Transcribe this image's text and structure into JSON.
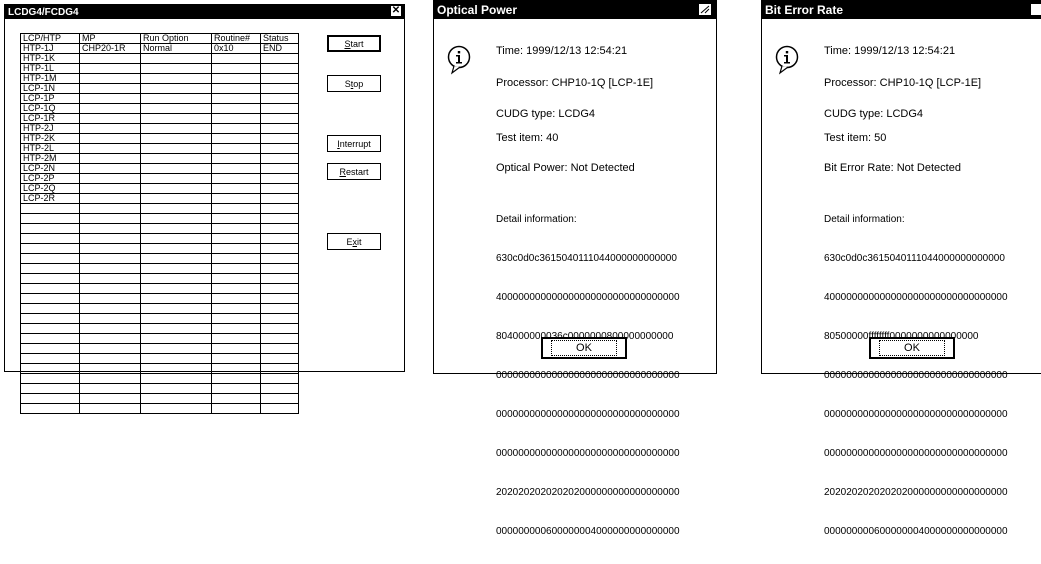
{
  "win1": {
    "title": "LCDG4/FCDG4",
    "close_glyph": "✕",
    "columns": [
      "LCP/HTP",
      "MP",
      "Run Option",
      "Routine#",
      "Status"
    ],
    "rows": [
      [
        "HTP-1J",
        "CHP20-1R",
        "Normal",
        "0x10",
        "END"
      ],
      [
        "HTP-1K",
        "",
        "",
        "",
        ""
      ],
      [
        "HTP-1L",
        "",
        "",
        "",
        ""
      ],
      [
        "HTP-1M",
        "",
        "",
        "",
        ""
      ],
      [
        "LCP-1N",
        "",
        "",
        "",
        ""
      ],
      [
        "LCP-1P",
        "",
        "",
        "",
        ""
      ],
      [
        "LCP-1Q",
        "",
        "",
        "",
        ""
      ],
      [
        "LCP-1R",
        "",
        "",
        "",
        ""
      ],
      [
        "HTP-2J",
        "",
        "",
        "",
        ""
      ],
      [
        "HTP-2K",
        "",
        "",
        "",
        ""
      ],
      [
        "HTP-2L",
        "",
        "",
        "",
        ""
      ],
      [
        "HTP-2M",
        "",
        "",
        "",
        ""
      ],
      [
        "LCP-2N",
        "",
        "",
        "",
        ""
      ],
      [
        "LCP-2P",
        "",
        "",
        "",
        ""
      ],
      [
        "LCP-2Q",
        "",
        "",
        "",
        ""
      ],
      [
        "LCP-2R",
        "",
        "",
        "",
        ""
      ],
      [
        "",
        "",
        "",
        "",
        ""
      ],
      [
        "",
        "",
        "",
        "",
        ""
      ],
      [
        "",
        "",
        "",
        "",
        ""
      ],
      [
        "",
        "",
        "",
        "",
        ""
      ],
      [
        "",
        "",
        "",
        "",
        ""
      ],
      [
        "",
        "",
        "",
        "",
        ""
      ],
      [
        "",
        "",
        "",
        "",
        ""
      ],
      [
        "",
        "",
        "",
        "",
        ""
      ],
      [
        "",
        "",
        "",
        "",
        ""
      ],
      [
        "",
        "",
        "",
        "",
        ""
      ],
      [
        "",
        "",
        "",
        "",
        ""
      ],
      [
        "",
        "",
        "",
        "",
        ""
      ],
      [
        "",
        "",
        "",
        "",
        ""
      ],
      [
        "",
        "",
        "",
        "",
        ""
      ],
      [
        "",
        "",
        "",
        "",
        ""
      ],
      [
        "",
        "",
        "",
        "",
        ""
      ],
      [
        "",
        "",
        "",
        "",
        ""
      ],
      [
        "",
        "",
        "",
        "",
        ""
      ],
      [
        "",
        "",
        "",
        "",
        ""
      ],
      [
        "",
        "",
        "",
        "",
        ""
      ],
      [
        "",
        "",
        "",
        "",
        ""
      ]
    ],
    "buttons": {
      "start": {
        "u": "S",
        "rest": "tart"
      },
      "stop": {
        "pre": "S",
        "u": "t",
        "rest": "op"
      },
      "interrupt": {
        "u": "I",
        "rest": "nterrupt"
      },
      "restart": {
        "u": "R",
        "rest": "estart"
      },
      "exit": {
        "pre": "E",
        "u": "x",
        "rest": "it"
      }
    }
  },
  "optical": {
    "title": "Optical Power",
    "time": "Time: 1999/12/13 12:54:21",
    "processor": "Processor: CHP10-1Q [LCP-1E]",
    "cudg": "CUDG type: LCDG4",
    "test_item": "Test item:  40",
    "result": "Optical Power: Not Detected",
    "detail_label": "Detail information:",
    "detail_lines": [
      "630c0d0c3615040111044000000000000",
      "400000000000000000000000000000000",
      "804000000036c0000000800000000000",
      "000000000000000000000000000000000",
      "000000000000000000000000000000000",
      "000000000000000000000000000000000",
      "202020202020202000000000000000000",
      "000000000600000004000000000000000"
    ],
    "ok": "OK"
  },
  "ber": {
    "title": "Bit Error Rate",
    "time": "Time: 1999/12/13 12:54:21",
    "processor": "Processor: CHP10-1Q [LCP-1E]",
    "cudg": "CUDG type: LCDG4",
    "test_item": "Test item:  50",
    "result": "Bit Error Rate: Not Detected",
    "detail_label": "Detail information:",
    "detail_lines": [
      "630c0d0c3615040111044000000000000",
      "400000000000000000000000000000000",
      "80500000ffffffff0000000000000000",
      "000000000000000000000000000000000",
      "000000000000000000000000000000000",
      "000000000000000000000000000000000",
      "202020202020202000000000000000000",
      "000000000600000004000000000000000"
    ],
    "ok": "OK"
  }
}
